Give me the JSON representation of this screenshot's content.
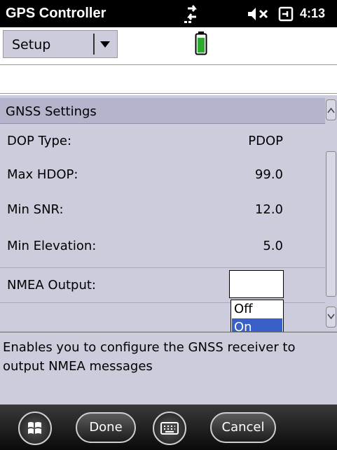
{
  "status_bar": {
    "app_title": "GPS Controller",
    "time": "4:13",
    "icons": [
      "sync-arrows-icon",
      "volume-muted-icon",
      "power-plug-icon"
    ]
  },
  "menu": {
    "selected": "Setup",
    "battery_icon": "battery-icon"
  },
  "settings": {
    "title": "GNSS Settings",
    "rows": [
      {
        "label": "DOP Type:",
        "value": "PDOP"
      },
      {
        "label": "Max HDOP:",
        "value": "99.0"
      },
      {
        "label": "Min SNR:",
        "value": "12.0"
      },
      {
        "label": "Min Elevation:",
        "value": "5.0"
      },
      {
        "label": "NMEA Output:",
        "value": ""
      }
    ],
    "nmea_dropdown": {
      "options": [
        "Off",
        "On"
      ],
      "highlighted": "On"
    }
  },
  "description": "Enables you to configure the GNSS receiver to output NMEA messages",
  "softkeys": {
    "done": "Done",
    "cancel": "Cancel"
  },
  "colors": {
    "panel": "#ccccdd",
    "highlight": "#3860c8",
    "title_bar": "#000000"
  }
}
